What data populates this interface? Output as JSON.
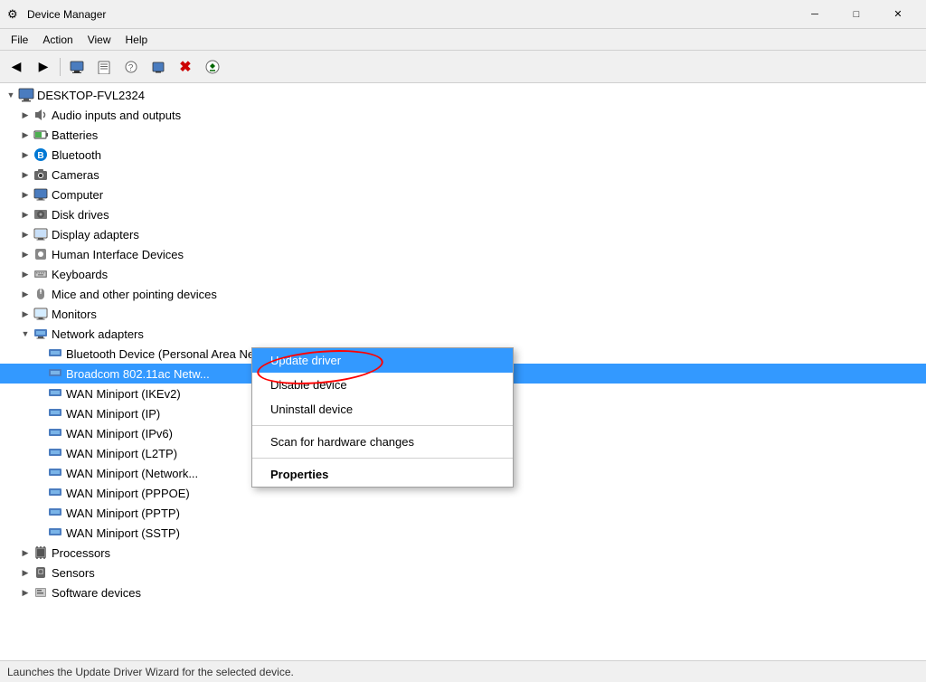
{
  "titleBar": {
    "title": "Device Manager",
    "iconSymbol": "⚙",
    "minimizeLabel": "─",
    "maximizeLabel": "□",
    "closeLabel": "✕"
  },
  "menuBar": {
    "items": [
      "File",
      "Action",
      "View",
      "Help"
    ]
  },
  "toolbar": {
    "buttons": [
      {
        "name": "back",
        "symbol": "◀",
        "tooltip": "Back"
      },
      {
        "name": "forward",
        "symbol": "▶",
        "tooltip": "Forward"
      },
      {
        "name": "properties",
        "symbol": "📋",
        "tooltip": "Properties"
      },
      {
        "name": "update",
        "symbol": "🔄",
        "tooltip": "Update Driver"
      },
      {
        "name": "scan",
        "symbol": "?",
        "tooltip": "Scan"
      },
      {
        "name": "computer",
        "symbol": "🖥",
        "tooltip": "Computer"
      },
      {
        "name": "remove",
        "symbol": "✖",
        "tooltip": "Remove"
      },
      {
        "name": "uninstall",
        "symbol": "⊛",
        "tooltip": "Uninstall"
      }
    ]
  },
  "tree": {
    "rootNode": "DESKTOP-FVL2324",
    "items": [
      {
        "id": "root",
        "label": "DESKTOP-FVL2324",
        "indent": 0,
        "expanded": true,
        "hasChildren": true,
        "icon": "computer"
      },
      {
        "id": "audio",
        "label": "Audio inputs and outputs",
        "indent": 1,
        "expanded": false,
        "hasChildren": true,
        "icon": "audio"
      },
      {
        "id": "batteries",
        "label": "Batteries",
        "indent": 1,
        "expanded": false,
        "hasChildren": true,
        "icon": "battery"
      },
      {
        "id": "bluetooth",
        "label": "Bluetooth",
        "indent": 1,
        "expanded": false,
        "hasChildren": true,
        "icon": "bluetooth"
      },
      {
        "id": "cameras",
        "label": "Cameras",
        "indent": 1,
        "expanded": false,
        "hasChildren": true,
        "icon": "camera"
      },
      {
        "id": "computer",
        "label": "Computer",
        "indent": 1,
        "expanded": false,
        "hasChildren": true,
        "icon": "monitor"
      },
      {
        "id": "disk",
        "label": "Disk drives",
        "indent": 1,
        "expanded": false,
        "hasChildren": true,
        "icon": "disk"
      },
      {
        "id": "display",
        "label": "Display adapters",
        "indent": 1,
        "expanded": false,
        "hasChildren": true,
        "icon": "display"
      },
      {
        "id": "hid",
        "label": "Human Interface Devices",
        "indent": 1,
        "expanded": false,
        "hasChildren": true,
        "icon": "hid"
      },
      {
        "id": "keyboards",
        "label": "Keyboards",
        "indent": 1,
        "expanded": false,
        "hasChildren": true,
        "icon": "keyboard"
      },
      {
        "id": "mice",
        "label": "Mice and other pointing devices",
        "indent": 1,
        "expanded": false,
        "hasChildren": true,
        "icon": "mouse"
      },
      {
        "id": "monitors",
        "label": "Monitors",
        "indent": 1,
        "expanded": false,
        "hasChildren": true,
        "icon": "monitor"
      },
      {
        "id": "network",
        "label": "Network adapters",
        "indent": 1,
        "expanded": true,
        "hasChildren": true,
        "icon": "network"
      },
      {
        "id": "net-bt",
        "label": "Bluetooth Device (Personal Area Network)",
        "indent": 2,
        "expanded": false,
        "hasChildren": false,
        "icon": "network"
      },
      {
        "id": "net-broadcom",
        "label": "Broadcom 802.11ac Netw...",
        "indent": 2,
        "expanded": false,
        "hasChildren": false,
        "icon": "network",
        "selected": true
      },
      {
        "id": "net-wan-ikev2",
        "label": "WAN Miniport (IKEv2)",
        "indent": 2,
        "expanded": false,
        "hasChildren": false,
        "icon": "network"
      },
      {
        "id": "net-wan-ip",
        "label": "WAN Miniport (IP)",
        "indent": 2,
        "expanded": false,
        "hasChildren": false,
        "icon": "network"
      },
      {
        "id": "net-wan-ipv6",
        "label": "WAN Miniport (IPv6)",
        "indent": 2,
        "expanded": false,
        "hasChildren": false,
        "icon": "network"
      },
      {
        "id": "net-wan-l2tp",
        "label": "WAN Miniport (L2TP)",
        "indent": 2,
        "expanded": false,
        "hasChildren": false,
        "icon": "network"
      },
      {
        "id": "net-wan-network",
        "label": "WAN Miniport (Network...",
        "indent": 2,
        "expanded": false,
        "hasChildren": false,
        "icon": "network"
      },
      {
        "id": "net-wan-pppoe",
        "label": "WAN Miniport (PPPOE)",
        "indent": 2,
        "expanded": false,
        "hasChildren": false,
        "icon": "network"
      },
      {
        "id": "net-wan-pptp",
        "label": "WAN Miniport (PPTP)",
        "indent": 2,
        "expanded": false,
        "hasChildren": false,
        "icon": "network"
      },
      {
        "id": "net-wan-sstp",
        "label": "WAN Miniport (SSTP)",
        "indent": 2,
        "expanded": false,
        "hasChildren": false,
        "icon": "network"
      },
      {
        "id": "processors",
        "label": "Processors",
        "indent": 1,
        "expanded": false,
        "hasChildren": true,
        "icon": "processor"
      },
      {
        "id": "sensors",
        "label": "Sensors",
        "indent": 1,
        "expanded": false,
        "hasChildren": true,
        "icon": "sensor"
      },
      {
        "id": "software",
        "label": "Software devices",
        "indent": 1,
        "expanded": false,
        "hasChildren": true,
        "icon": "software"
      }
    ]
  },
  "contextMenu": {
    "items": [
      {
        "id": "update-driver",
        "label": "Update driver",
        "bold": false,
        "active": true
      },
      {
        "id": "disable-device",
        "label": "Disable device",
        "bold": false,
        "active": false
      },
      {
        "id": "uninstall-device",
        "label": "Uninstall device",
        "bold": false,
        "active": false
      },
      {
        "id": "separator",
        "type": "separator"
      },
      {
        "id": "scan-changes",
        "label": "Scan for hardware changes",
        "bold": false,
        "active": false
      },
      {
        "id": "separator2",
        "type": "separator"
      },
      {
        "id": "properties",
        "label": "Properties",
        "bold": true,
        "active": false
      }
    ]
  },
  "statusBar": {
    "text": "Launches the Update Driver Wizard for the selected device."
  }
}
